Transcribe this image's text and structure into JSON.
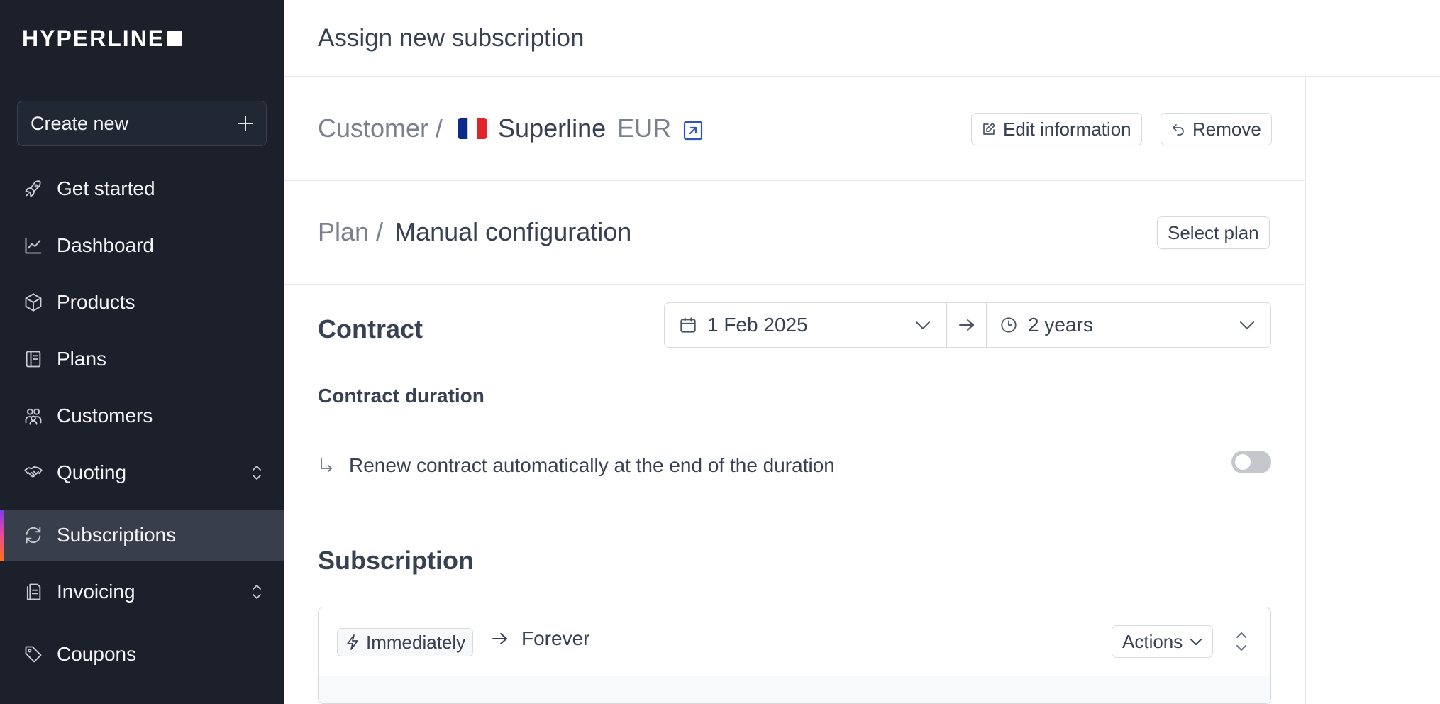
{
  "brand": {
    "logo_text": "HYPERLINE"
  },
  "sidebar": {
    "create_label": "Create new",
    "items": [
      {
        "label": "Get started",
        "icon": "rocket-icon"
      },
      {
        "label": "Dashboard",
        "icon": "chart-line-icon"
      },
      {
        "label": "Products",
        "icon": "box-icon"
      },
      {
        "label": "Plans",
        "icon": "book-icon"
      },
      {
        "label": "Customers",
        "icon": "users-icon"
      },
      {
        "label": "Quoting",
        "icon": "handshake-icon",
        "expandable": true
      },
      {
        "label": "Subscriptions",
        "icon": "refresh-icon",
        "active": true
      },
      {
        "label": "Invoicing",
        "icon": "document-icon",
        "expandable": true
      },
      {
        "label": "Coupons",
        "icon": "tag-icon"
      }
    ]
  },
  "header": {
    "title": "Assign new subscription"
  },
  "customer": {
    "prefix": "Customer /",
    "name": "Superline",
    "currency": "EUR",
    "flag": "France",
    "edit_label": "Edit information",
    "remove_label": "Remove"
  },
  "plan": {
    "prefix": "Plan /",
    "name": "Manual configuration",
    "select_label": "Select plan"
  },
  "contract": {
    "title": "Contract",
    "enabled": true,
    "duration_label": "Contract duration",
    "start_date": "1 Feb 2025",
    "duration": "2 years",
    "renew_label": "Renew contract automatically at the end of the duration",
    "renew_enabled": false
  },
  "subscription": {
    "title": "Subscription",
    "start": "Immediately",
    "end": "Forever",
    "actions_label": "Actions"
  },
  "colors": {
    "sidebar_bg": "#1c202b",
    "accent": "#3b5bdb",
    "link": "#2b57c5"
  }
}
